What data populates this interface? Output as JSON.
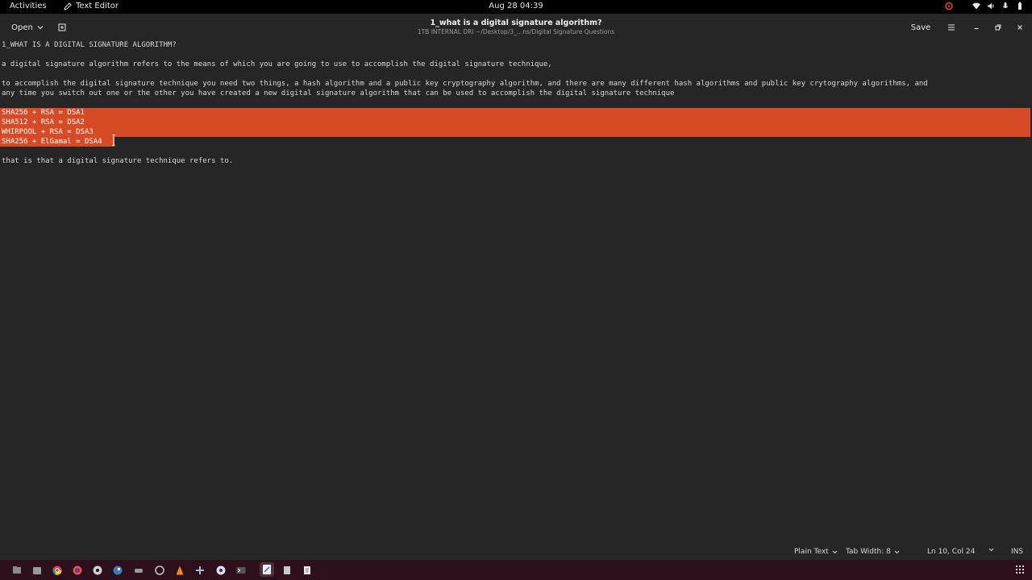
{
  "topbar": {
    "activities": "Activities",
    "app_name": "Text Editor",
    "datetime": "Aug 28  04:39"
  },
  "header": {
    "open_label": "Open",
    "title": "1_what is a digital signature algorithm?",
    "subtitle": "1TB INTERNAL DRI ~/Desktop/3_…ns/Digital Signature Questions",
    "save_label": "Save"
  },
  "document": {
    "lines": [
      "1_WHAT IS A DIGITAL SIGNATURE ALGORITHM?",
      "",
      "a digital signature algorithm refers to the means of which you are going to use to accomplish the digital signature technique,",
      "",
      "to accomplish the digital signature technique you need two things, a hash algorithm and a public key cryptography algorithm, and there are many different hash algorithms and public key crytography algorithms, and",
      "any time you switch out one or the other you have created a new digital signature algorithm that can be used to accomplish the digital signature technique",
      "",
      "SHA256 + RSA = DSA1",
      "SHA512 + RSA = DSA2",
      "WHIRPOOL + RSA = DSA3",
      "SHA256 + ElGamal = DSA4",
      "",
      "that is that a digital signature technique refers to."
    ]
  },
  "statusbar": {
    "language": "Plain Text",
    "tab_width": "Tab Width: 8",
    "position": "Ln 10, Col 24",
    "mode": "INS"
  },
  "colors": {
    "selection": "#d64a26",
    "background": "#262626",
    "topbar": "#000000",
    "dock": "#2e0f1c"
  }
}
